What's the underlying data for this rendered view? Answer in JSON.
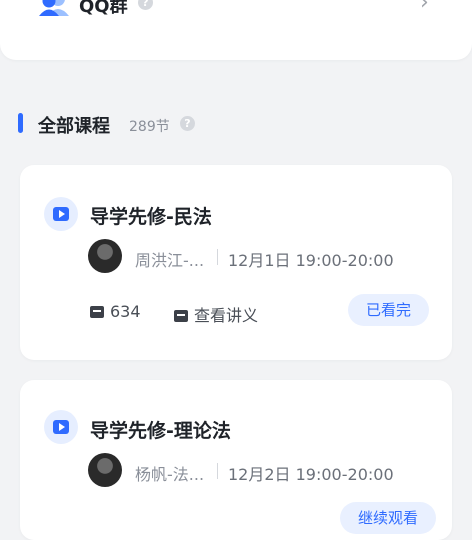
{
  "qq_group": {
    "label": "QQ群",
    "help_icon": "question-icon",
    "chevron": "›"
  },
  "section": {
    "title": "全部课程",
    "count": "289节",
    "help_icon": "question-icon",
    "accent": "#2f6bff"
  },
  "courses": [
    {
      "title": "导学先修-民法",
      "teacher": "周洪江-...",
      "time": "12月1日 19:00-20:00",
      "comments": "634",
      "handout_label": "查看讲义",
      "status": "已看完"
    },
    {
      "title": "导学先修-理论法",
      "teacher": "杨帆-法...",
      "time": "12月2日 19:00-20:00",
      "status": "继续观看"
    }
  ],
  "colors": {
    "background": "#f2f3f5",
    "card": "#ffffff",
    "accent": "#2f6bff",
    "pill_bg": "#e9f0ff"
  }
}
